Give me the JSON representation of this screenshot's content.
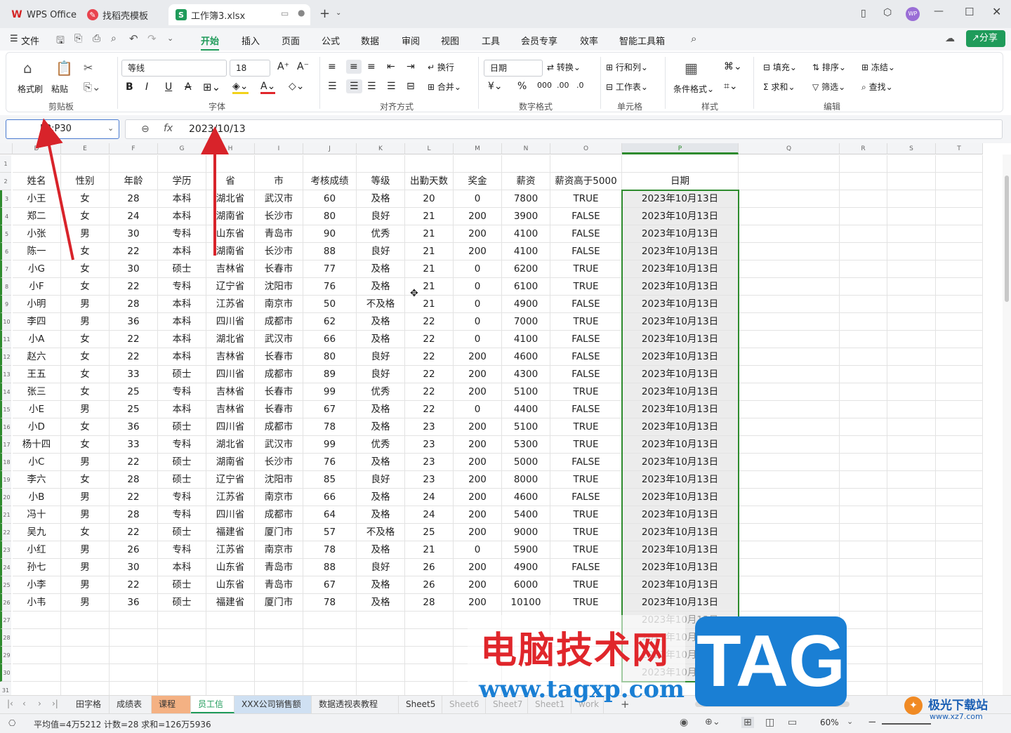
{
  "titlebar": {
    "tabs": [
      {
        "label": "WPS Office",
        "icon": "wps-logo-icon"
      },
      {
        "label": "找稻壳模板",
        "icon": "docer-icon"
      },
      {
        "label": "工作簿3.xlsx",
        "icon": "sheet-file-icon"
      }
    ],
    "avatar": "WP"
  },
  "menu": {
    "file": "文件",
    "items": [
      "开始",
      "插入",
      "页面",
      "公式",
      "数据",
      "审阅",
      "视图",
      "工具",
      "会员专享",
      "效率",
      "智能工具箱"
    ],
    "active": "开始",
    "share": "分享"
  },
  "ribbon": {
    "clipboard": {
      "format_painter": "格式刷",
      "paste": "粘贴",
      "group": "剪贴板"
    },
    "font": {
      "name": "等线",
      "size": "18",
      "group": "字体"
    },
    "align": {
      "wrap": "换行",
      "merge": "合并",
      "group": "对齐方式"
    },
    "number": {
      "format": "日期",
      "convert": "转换",
      "group": "数字格式"
    },
    "cells": {
      "rowcol": "行和列",
      "sheet": "工作表",
      "group": "单元格"
    },
    "styles": {
      "cond": "条件格式",
      "group": "样式"
    },
    "edit": {
      "fill": "填充",
      "sort": "排序",
      "freeze": "冻结",
      "sum": "求和",
      "filter": "筛选",
      "find": "查找",
      "group": "编辑"
    }
  },
  "formula": {
    "namebox": "P3:P30",
    "value": "2023/10/13",
    "fx": "fx"
  },
  "columns": [
    "D",
    "E",
    "F",
    "G",
    "H",
    "I",
    "J",
    "K",
    "L",
    "M",
    "N",
    "O",
    "P",
    "Q",
    "R",
    "S",
    "T"
  ],
  "headers": [
    "姓名",
    "性别",
    "年龄",
    "学历",
    "省",
    "市",
    "考核成绩",
    "等级",
    "出勤天数",
    "奖金",
    "薪资",
    "薪资高于5000",
    "日期"
  ],
  "rows": [
    [
      "小王",
      "女",
      "28",
      "本科",
      "湖北省",
      "武汉市",
      "60",
      "及格",
      "20",
      "0",
      "7800",
      "TRUE",
      "2023年10月13日"
    ],
    [
      "郑二",
      "女",
      "24",
      "本科",
      "湖南省",
      "长沙市",
      "80",
      "良好",
      "21",
      "200",
      "3900",
      "FALSE",
      "2023年10月13日"
    ],
    [
      "小张",
      "男",
      "30",
      "专科",
      "山东省",
      "青岛市",
      "90",
      "优秀",
      "21",
      "200",
      "4100",
      "FALSE",
      "2023年10月13日"
    ],
    [
      "陈一",
      "女",
      "22",
      "本科",
      "湖南省",
      "长沙市",
      "88",
      "良好",
      "21",
      "200",
      "4100",
      "FALSE",
      "2023年10月13日"
    ],
    [
      "小G",
      "女",
      "30",
      "硕士",
      "吉林省",
      "长春市",
      "77",
      "及格",
      "21",
      "0",
      "6200",
      "TRUE",
      "2023年10月13日"
    ],
    [
      "小F",
      "女",
      "22",
      "专科",
      "辽宁省",
      "沈阳市",
      "76",
      "及格",
      "21",
      "0",
      "6100",
      "TRUE",
      "2023年10月13日"
    ],
    [
      "小明",
      "男",
      "28",
      "本科",
      "江苏省",
      "南京市",
      "50",
      "不及格",
      "21",
      "0",
      "4900",
      "FALSE",
      "2023年10月13日"
    ],
    [
      "李四",
      "男",
      "36",
      "本科",
      "四川省",
      "成都市",
      "62",
      "及格",
      "22",
      "0",
      "7000",
      "TRUE",
      "2023年10月13日"
    ],
    [
      "小A",
      "女",
      "22",
      "本科",
      "湖北省",
      "武汉市",
      "66",
      "及格",
      "22",
      "0",
      "4100",
      "FALSE",
      "2023年10月13日"
    ],
    [
      "赵六",
      "女",
      "22",
      "本科",
      "吉林省",
      "长春市",
      "80",
      "良好",
      "22",
      "200",
      "4600",
      "FALSE",
      "2023年10月13日"
    ],
    [
      "王五",
      "女",
      "33",
      "硕士",
      "四川省",
      "成都市",
      "89",
      "良好",
      "22",
      "200",
      "4300",
      "FALSE",
      "2023年10月13日"
    ],
    [
      "张三",
      "女",
      "25",
      "专科",
      "吉林省",
      "长春市",
      "99",
      "优秀",
      "22",
      "200",
      "5100",
      "TRUE",
      "2023年10月13日"
    ],
    [
      "小E",
      "男",
      "25",
      "本科",
      "吉林省",
      "长春市",
      "67",
      "及格",
      "22",
      "0",
      "4400",
      "FALSE",
      "2023年10月13日"
    ],
    [
      "小D",
      "女",
      "36",
      "硕士",
      "四川省",
      "成都市",
      "78",
      "及格",
      "23",
      "200",
      "5100",
      "TRUE",
      "2023年10月13日"
    ],
    [
      "杨十四",
      "女",
      "33",
      "专科",
      "湖北省",
      "武汉市",
      "99",
      "优秀",
      "23",
      "200",
      "5300",
      "TRUE",
      "2023年10月13日"
    ],
    [
      "小C",
      "男",
      "22",
      "硕士",
      "湖南省",
      "长沙市",
      "76",
      "及格",
      "23",
      "200",
      "5000",
      "FALSE",
      "2023年10月13日"
    ],
    [
      "李六",
      "女",
      "28",
      "硕士",
      "辽宁省",
      "沈阳市",
      "85",
      "良好",
      "23",
      "200",
      "8000",
      "TRUE",
      "2023年10月13日"
    ],
    [
      "小B",
      "男",
      "22",
      "专科",
      "江苏省",
      "南京市",
      "66",
      "及格",
      "24",
      "200",
      "4600",
      "FALSE",
      "2023年10月13日"
    ],
    [
      "冯十",
      "男",
      "28",
      "专科",
      "四川省",
      "成都市",
      "64",
      "及格",
      "24",
      "200",
      "5400",
      "TRUE",
      "2023年10月13日"
    ],
    [
      "吴九",
      "女",
      "22",
      "硕士",
      "福建省",
      "厦门市",
      "57",
      "不及格",
      "25",
      "200",
      "9000",
      "TRUE",
      "2023年10月13日"
    ],
    [
      "小红",
      "男",
      "26",
      "专科",
      "江苏省",
      "南京市",
      "78",
      "及格",
      "21",
      "0",
      "5900",
      "TRUE",
      "2023年10月13日"
    ],
    [
      "孙七",
      "男",
      "30",
      "本科",
      "山东省",
      "青岛市",
      "88",
      "良好",
      "26",
      "200",
      "4900",
      "FALSE",
      "2023年10月13日"
    ],
    [
      "小李",
      "男",
      "22",
      "硕士",
      "山东省",
      "青岛市",
      "67",
      "及格",
      "26",
      "200",
      "6000",
      "TRUE",
      "2023年10月13日"
    ],
    [
      "小韦",
      "男",
      "36",
      "硕士",
      "福建省",
      "厦门市",
      "78",
      "及格",
      "28",
      "200",
      "10100",
      "TRUE",
      "2023年10月13日"
    ]
  ],
  "extra_dates": [
    "2023年10月13日",
    "2023年10月13日",
    "2023年10月13日",
    "2023年10月13日"
  ],
  "row_numbers": [
    "1",
    "2",
    "3",
    "4",
    "5",
    "6",
    "7",
    "8",
    "9",
    "10",
    "11",
    "12",
    "13",
    "14",
    "15",
    "16",
    "17",
    "18",
    "19",
    "20",
    "21",
    "22",
    "23",
    "24",
    "25",
    "26",
    "27",
    "28",
    "29",
    "30",
    "31"
  ],
  "sheets": [
    "田字格",
    "成绩表",
    "课程表",
    "员工信息",
    "XXX公司销售额",
    "数据透视表教程",
    "Sheet5",
    "Sheet6",
    "Sheet7",
    "Sheet1",
    "work"
  ],
  "active_sheet": "员工信息",
  "status": {
    "summary": "平均值=4万5212  计数=28  求和=126万5936",
    "zoom": "60%"
  },
  "watermark": {
    "title": "电脑技术网",
    "url": "www.tagxp.com",
    "tag": "TAG",
    "brand": "极光下载站",
    "brand_url": "www.xz7.com"
  },
  "colors": {
    "accent": "#1f9b5a",
    "selection": "#2e8b2e",
    "arrow": "#d8232a",
    "watermark_blue": "#1a7fd4"
  }
}
